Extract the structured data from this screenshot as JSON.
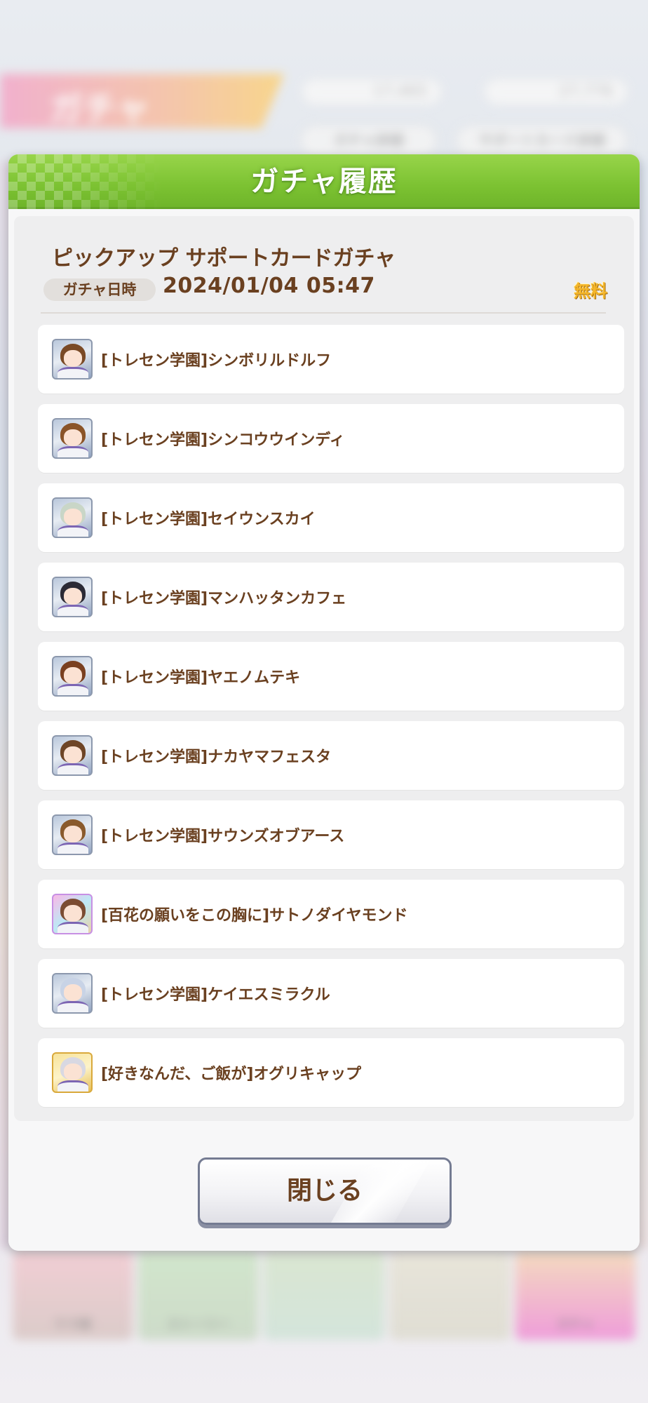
{
  "background": {
    "screen_title": "ガチャ",
    "currency_1": "17,465",
    "currency_2": "27,776",
    "pill_1": "ガチャ詳細",
    "pill_2": "サポートカード詳細",
    "nav": [
      "ウマ娘",
      "ストーリー",
      "",
      "",
      "ガチャ"
    ]
  },
  "modal": {
    "title": "ガチャ履歴",
    "gacha_name": "ピックアップ サポートカードガチャ",
    "date_label": "ガチャ日時",
    "date_value": "2024/01/04 05:47",
    "free_badge": "無料",
    "cards": [
      {
        "label": "[トレセン学園]シンボリルドルフ",
        "frame": "silver",
        "hair": "#7a4a26"
      },
      {
        "label": "[トレセン学園]シンコウウインディ",
        "frame": "silver",
        "hair": "#8a5428"
      },
      {
        "label": "[トレセン学園]セイウンスカイ",
        "frame": "silver",
        "hair": "#c9d6c7"
      },
      {
        "label": "[トレセン学園]マンハッタンカフェ",
        "frame": "silver",
        "hair": "#2b2a35"
      },
      {
        "label": "[トレセン学園]ヤエノムテキ",
        "frame": "silver",
        "hair": "#7a4020"
      },
      {
        "label": "[トレセン学園]ナカヤマフェスタ",
        "frame": "silver",
        "hair": "#6e4526"
      },
      {
        "label": "[トレセン学園]サウンズオブアース",
        "frame": "silver",
        "hair": "#8a5a2c"
      },
      {
        "label": "[百花の願いをこの胸に]サトノダイヤモンド",
        "frame": "rainbow",
        "hair": "#7b4c32"
      },
      {
        "label": "[トレセン学園]ケイエスミラクル",
        "frame": "silver",
        "hair": "#c8d3e6"
      },
      {
        "label": "[好きなんだ、ご飯が]オグリキャップ",
        "frame": "gold",
        "hair": "#d8d8e2"
      }
    ],
    "close_button": "閉じる"
  },
  "colors": {
    "header_green": "#7cc232",
    "text_brown": "#6a4020",
    "free_gold": "#f5b62a"
  }
}
